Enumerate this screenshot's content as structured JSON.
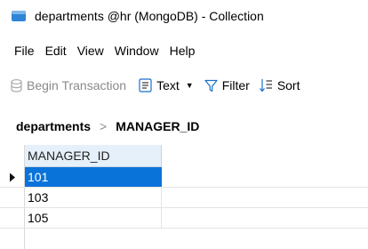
{
  "window": {
    "title": "departments @hr (MongoDB) - Collection",
    "icon": "collection-app-icon",
    "accent_color": "#2f84d6"
  },
  "menu": {
    "items": [
      "File",
      "Edit",
      "View",
      "Window",
      "Help"
    ]
  },
  "toolbar": {
    "begin_transaction": "Begin Transaction",
    "text_view": "Text",
    "filter": "Filter",
    "sort": "Sort"
  },
  "breadcrumb": {
    "collection": "departments",
    "field": "MANAGER_ID"
  },
  "grid": {
    "column_header": "MANAGER_ID",
    "rows": [
      "101",
      "103",
      "105"
    ],
    "selected_row": 0,
    "selection_color": "#0a73d9"
  }
}
